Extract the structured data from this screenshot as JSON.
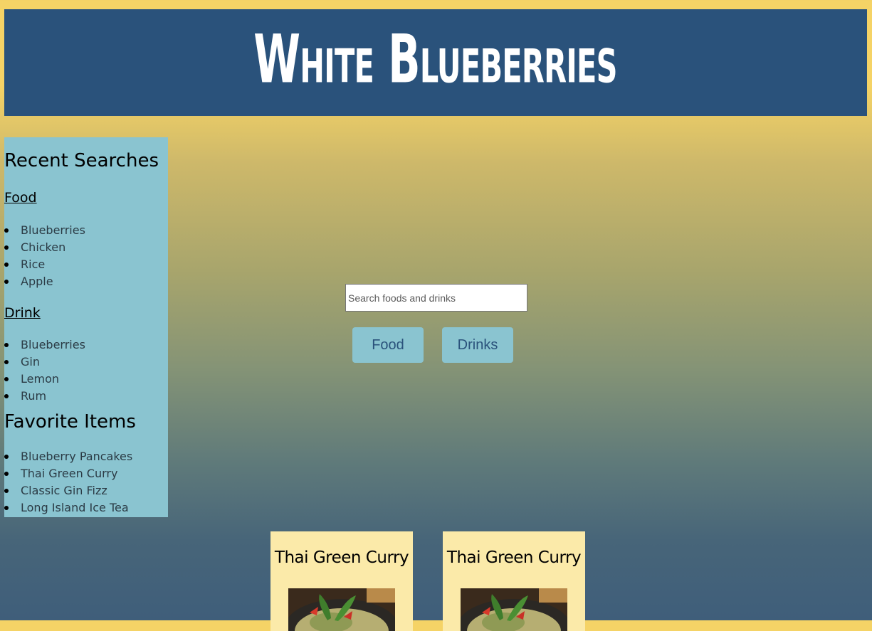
{
  "header": {
    "title": "White Blueberries"
  },
  "sidebar": {
    "recent_heading": "Recent Searches",
    "food_heading": "Food",
    "food_items": [
      "Blueberries",
      "Chicken",
      "Rice",
      "Apple"
    ],
    "drink_heading": "Drink",
    "drink_items": [
      "Blueberries",
      "Gin",
      "Lemon",
      "Rum"
    ],
    "favorites_heading": "Favorite Items",
    "favorite_items": [
      "Blueberry Pancakes",
      "Thai Green Curry",
      "Classic Gin Fizz",
      "Long Island Ice Tea"
    ]
  },
  "search": {
    "placeholder": "Search foods and drinks",
    "food_button": "Food",
    "drinks_button": "Drinks"
  },
  "cards": [
    {
      "title": "Thai Green Curry"
    },
    {
      "title": "Thai Green Curry"
    }
  ],
  "colors": {
    "header_bg": "#2a527b",
    "sidebar_bg": "#8ac4d0",
    "card_bg": "#fbeaa9",
    "page_top": "#f5d366",
    "page_bottom": "#3f5e7a"
  }
}
